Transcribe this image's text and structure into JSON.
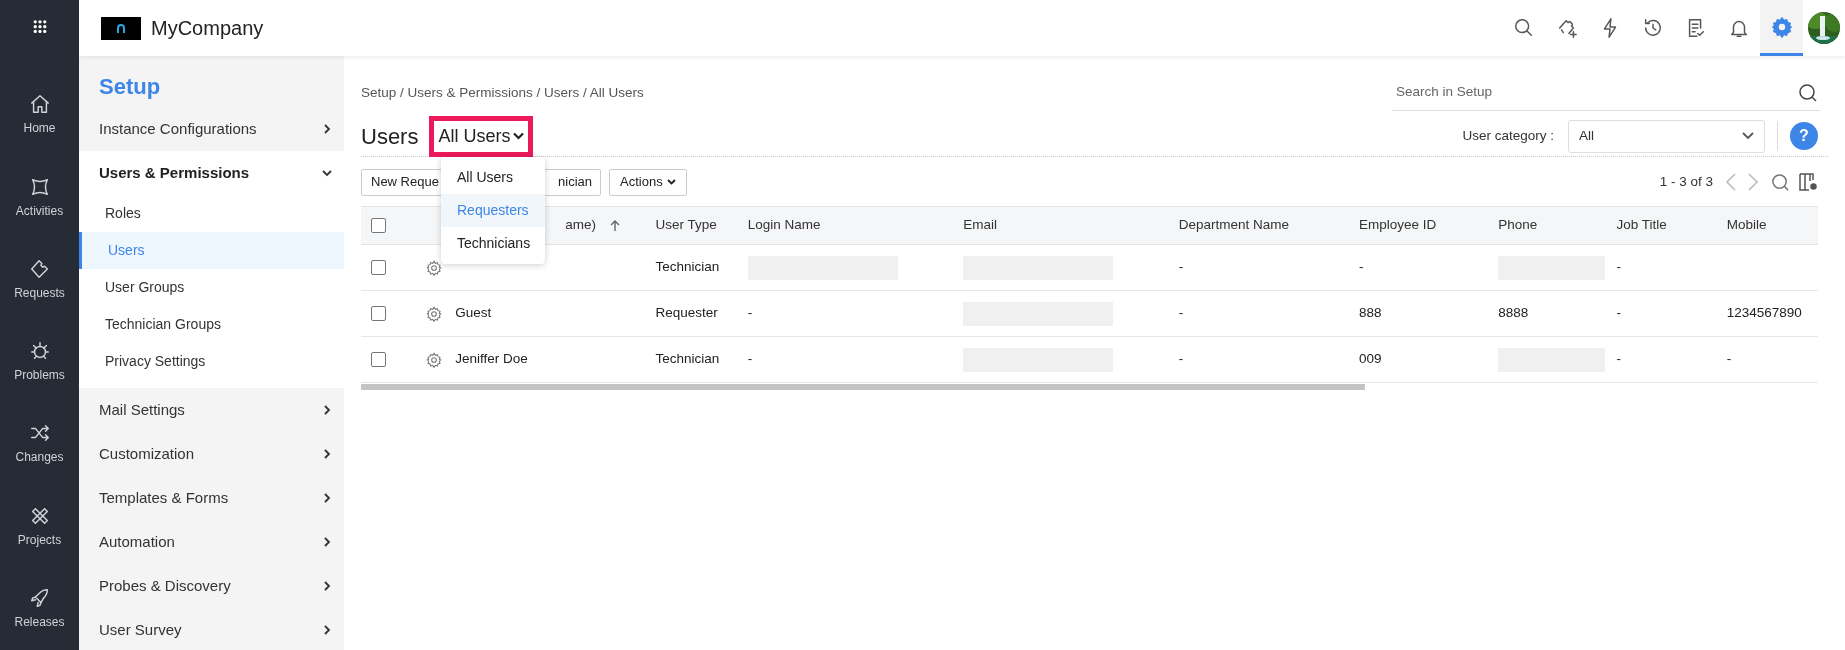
{
  "top_bar": {
    "company": "MyCompany",
    "icons": [
      {
        "kind": "search",
        "selected": false
      },
      {
        "kind": "ticket-add",
        "selected": false
      },
      {
        "kind": "bolt",
        "selected": false
      },
      {
        "kind": "history",
        "selected": false
      },
      {
        "kind": "checklist",
        "selected": false
      },
      {
        "kind": "bell",
        "selected": false
      },
      {
        "kind": "gear",
        "selected": true
      }
    ]
  },
  "rail": {
    "items": [
      {
        "kind": "home",
        "label": "Home"
      },
      {
        "kind": "activities",
        "label": "Activities"
      },
      {
        "kind": "requests",
        "label": "Requests"
      },
      {
        "kind": "problems",
        "label": "Problems"
      },
      {
        "kind": "changes",
        "label": "Changes"
      },
      {
        "kind": "projects",
        "label": "Projects"
      },
      {
        "kind": "releases",
        "label": "Releases"
      }
    ]
  },
  "setup_nav": {
    "title": "Setup",
    "sections": [
      {
        "label": "Instance Configurations",
        "expanded": false
      },
      {
        "label": "Users & Permissions",
        "expanded": true,
        "children": [
          {
            "label": "Roles",
            "selected": false
          },
          {
            "label": "Users",
            "selected": true
          },
          {
            "label": "User Groups",
            "selected": false
          },
          {
            "label": "Technician Groups",
            "selected": false
          },
          {
            "label": "Privacy Settings",
            "selected": false
          }
        ]
      },
      {
        "label": "Mail Settings",
        "expanded": false
      },
      {
        "label": "Customization",
        "expanded": false
      },
      {
        "label": "Templates & Forms",
        "expanded": false
      },
      {
        "label": "Automation",
        "expanded": false
      },
      {
        "label": "Probes & Discovery",
        "expanded": false
      },
      {
        "label": "User Survey",
        "expanded": false
      }
    ]
  },
  "breadcrumb": "Setup / Users & Permissions / Users / All Users",
  "search": {
    "placeholder": "Search in Setup"
  },
  "title": "Users",
  "view_selector": {
    "value": "All Users",
    "highlighted": true,
    "options": [
      {
        "label": "All Users",
        "highlighted": false
      },
      {
        "label": "Requesters",
        "highlighted": true
      },
      {
        "label": "Technicians",
        "highlighted": false
      }
    ]
  },
  "user_category": {
    "label": "User category :",
    "value": "All"
  },
  "help": "?",
  "toolbar": {
    "buttons": [
      "New Reque",
      "nician"
    ],
    "actions": "Actions",
    "pagination": "1 - 3 of 3"
  },
  "table": {
    "all_checked": false,
    "columns": [
      "ame)",
      "User Type",
      "Login Name",
      "Email",
      "Department Name",
      "Employee ID",
      "Phone",
      "Job Title",
      "Mobile"
    ],
    "rows": [
      {
        "checked": false,
        "cells": [
          "",
          "Technician",
          {
            "redacted": true
          },
          {
            "redacted": true
          },
          "-",
          "-",
          {
            "redacted": true
          },
          "-",
          ""
        ]
      },
      {
        "checked": false,
        "cells": [
          "Guest",
          "Requester",
          "-",
          {
            "redacted": true
          },
          "-",
          "888",
          "8888",
          "-",
          "1234567890"
        ]
      },
      {
        "checked": false,
        "cells": [
          "Jeniffer Doe",
          "Technician",
          "-",
          {
            "redacted": true
          },
          "-",
          "009",
          {
            "redacted": true
          },
          "-",
          "-"
        ]
      }
    ]
  }
}
